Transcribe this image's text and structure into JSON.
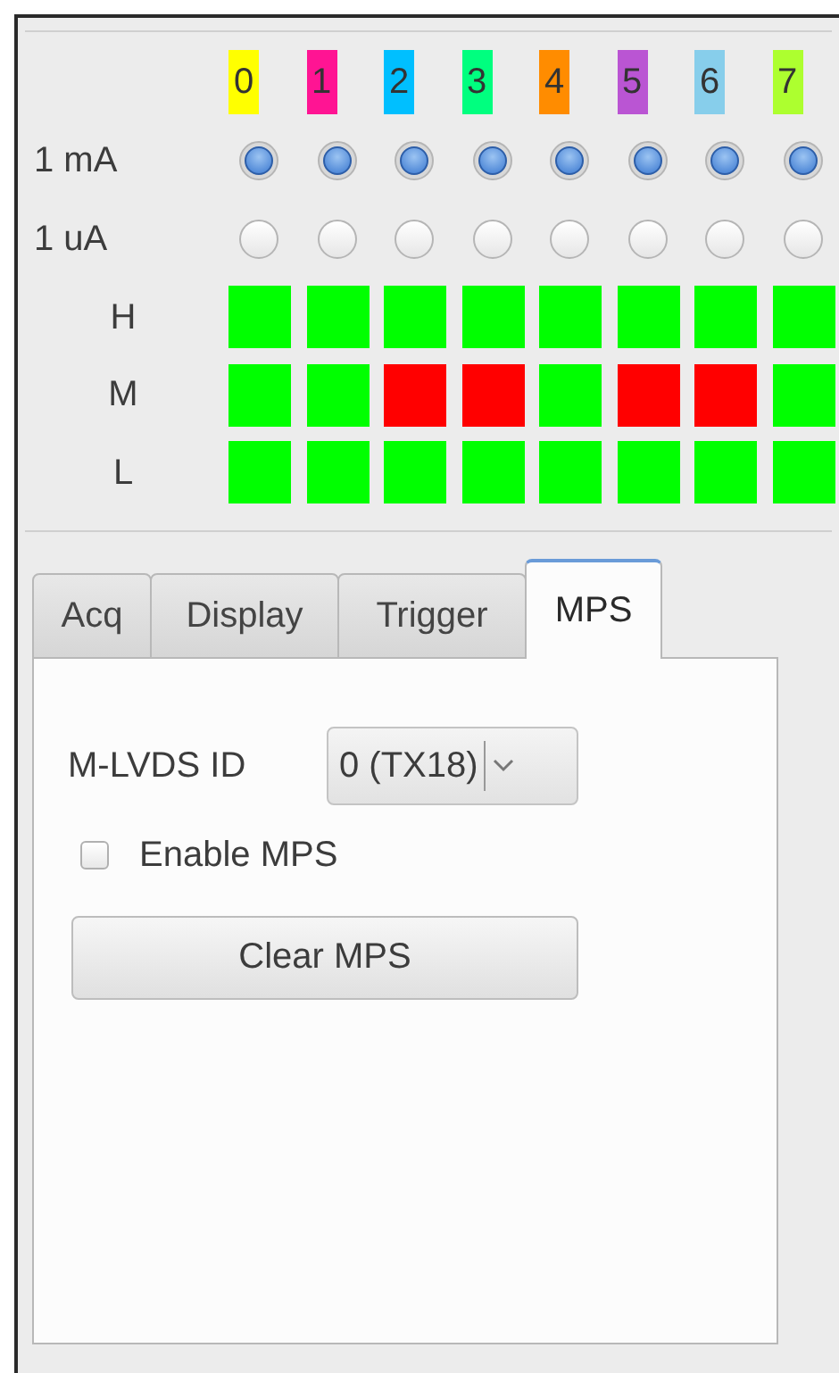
{
  "channels": [
    {
      "label": "0",
      "color": "#ffff00"
    },
    {
      "label": "1",
      "color": "#ff1493"
    },
    {
      "label": "2",
      "color": "#00bfff"
    },
    {
      "label": "3",
      "color": "#00ff7f"
    },
    {
      "label": "4",
      "color": "#ff8c00"
    },
    {
      "label": "5",
      "color": "#ba55d3"
    },
    {
      "label": "6",
      "color": "#87ceeb"
    },
    {
      "label": "7",
      "color": "#adff2f"
    }
  ],
  "rows": [
    {
      "label": "1 mA",
      "kind": "radio",
      "cells": [
        {
          "selected": true
        },
        {
          "selected": true
        },
        {
          "selected": true
        },
        {
          "selected": true
        },
        {
          "selected": true
        },
        {
          "selected": true
        },
        {
          "selected": true
        },
        {
          "selected": true
        }
      ]
    },
    {
      "label": "1 uA",
      "kind": "radio",
      "cells": [
        {
          "selected": false
        },
        {
          "selected": false
        },
        {
          "selected": false
        },
        {
          "selected": false
        },
        {
          "selected": false
        },
        {
          "selected": false
        },
        {
          "selected": false
        },
        {
          "selected": false
        }
      ]
    },
    {
      "label": "H",
      "kind": "led",
      "cells": [
        {
          "color": "#00ff00"
        },
        {
          "color": "#00ff00"
        },
        {
          "color": "#00ff00"
        },
        {
          "color": "#00ff00"
        },
        {
          "color": "#00ff00"
        },
        {
          "color": "#00ff00"
        },
        {
          "color": "#00ff00"
        },
        {
          "color": "#00ff00"
        }
      ]
    },
    {
      "label": "M",
      "kind": "led",
      "cells": [
        {
          "color": "#00ff00"
        },
        {
          "color": "#00ff00"
        },
        {
          "color": "#ff0000"
        },
        {
          "color": "#ff0000"
        },
        {
          "color": "#00ff00"
        },
        {
          "color": "#ff0000"
        },
        {
          "color": "#ff0000"
        },
        {
          "color": "#00ff00"
        }
      ]
    },
    {
      "label": "L",
      "kind": "led",
      "cells": [
        {
          "color": "#00ff00"
        },
        {
          "color": "#00ff00"
        },
        {
          "color": "#00ff00"
        },
        {
          "color": "#00ff00"
        },
        {
          "color": "#00ff00"
        },
        {
          "color": "#00ff00"
        },
        {
          "color": "#00ff00"
        },
        {
          "color": "#00ff00"
        }
      ]
    }
  ],
  "tabs": [
    {
      "label": "Acq",
      "selected": false
    },
    {
      "label": "Display",
      "selected": false
    },
    {
      "label": "Trigger",
      "selected": false
    },
    {
      "label": "MPS",
      "selected": true
    }
  ],
  "mps": {
    "id_label": "M-LVDS ID",
    "id_value": "0 (TX18)",
    "enable": {
      "label": "Enable MPS",
      "checked": false
    },
    "clear_button": "Clear MPS"
  }
}
